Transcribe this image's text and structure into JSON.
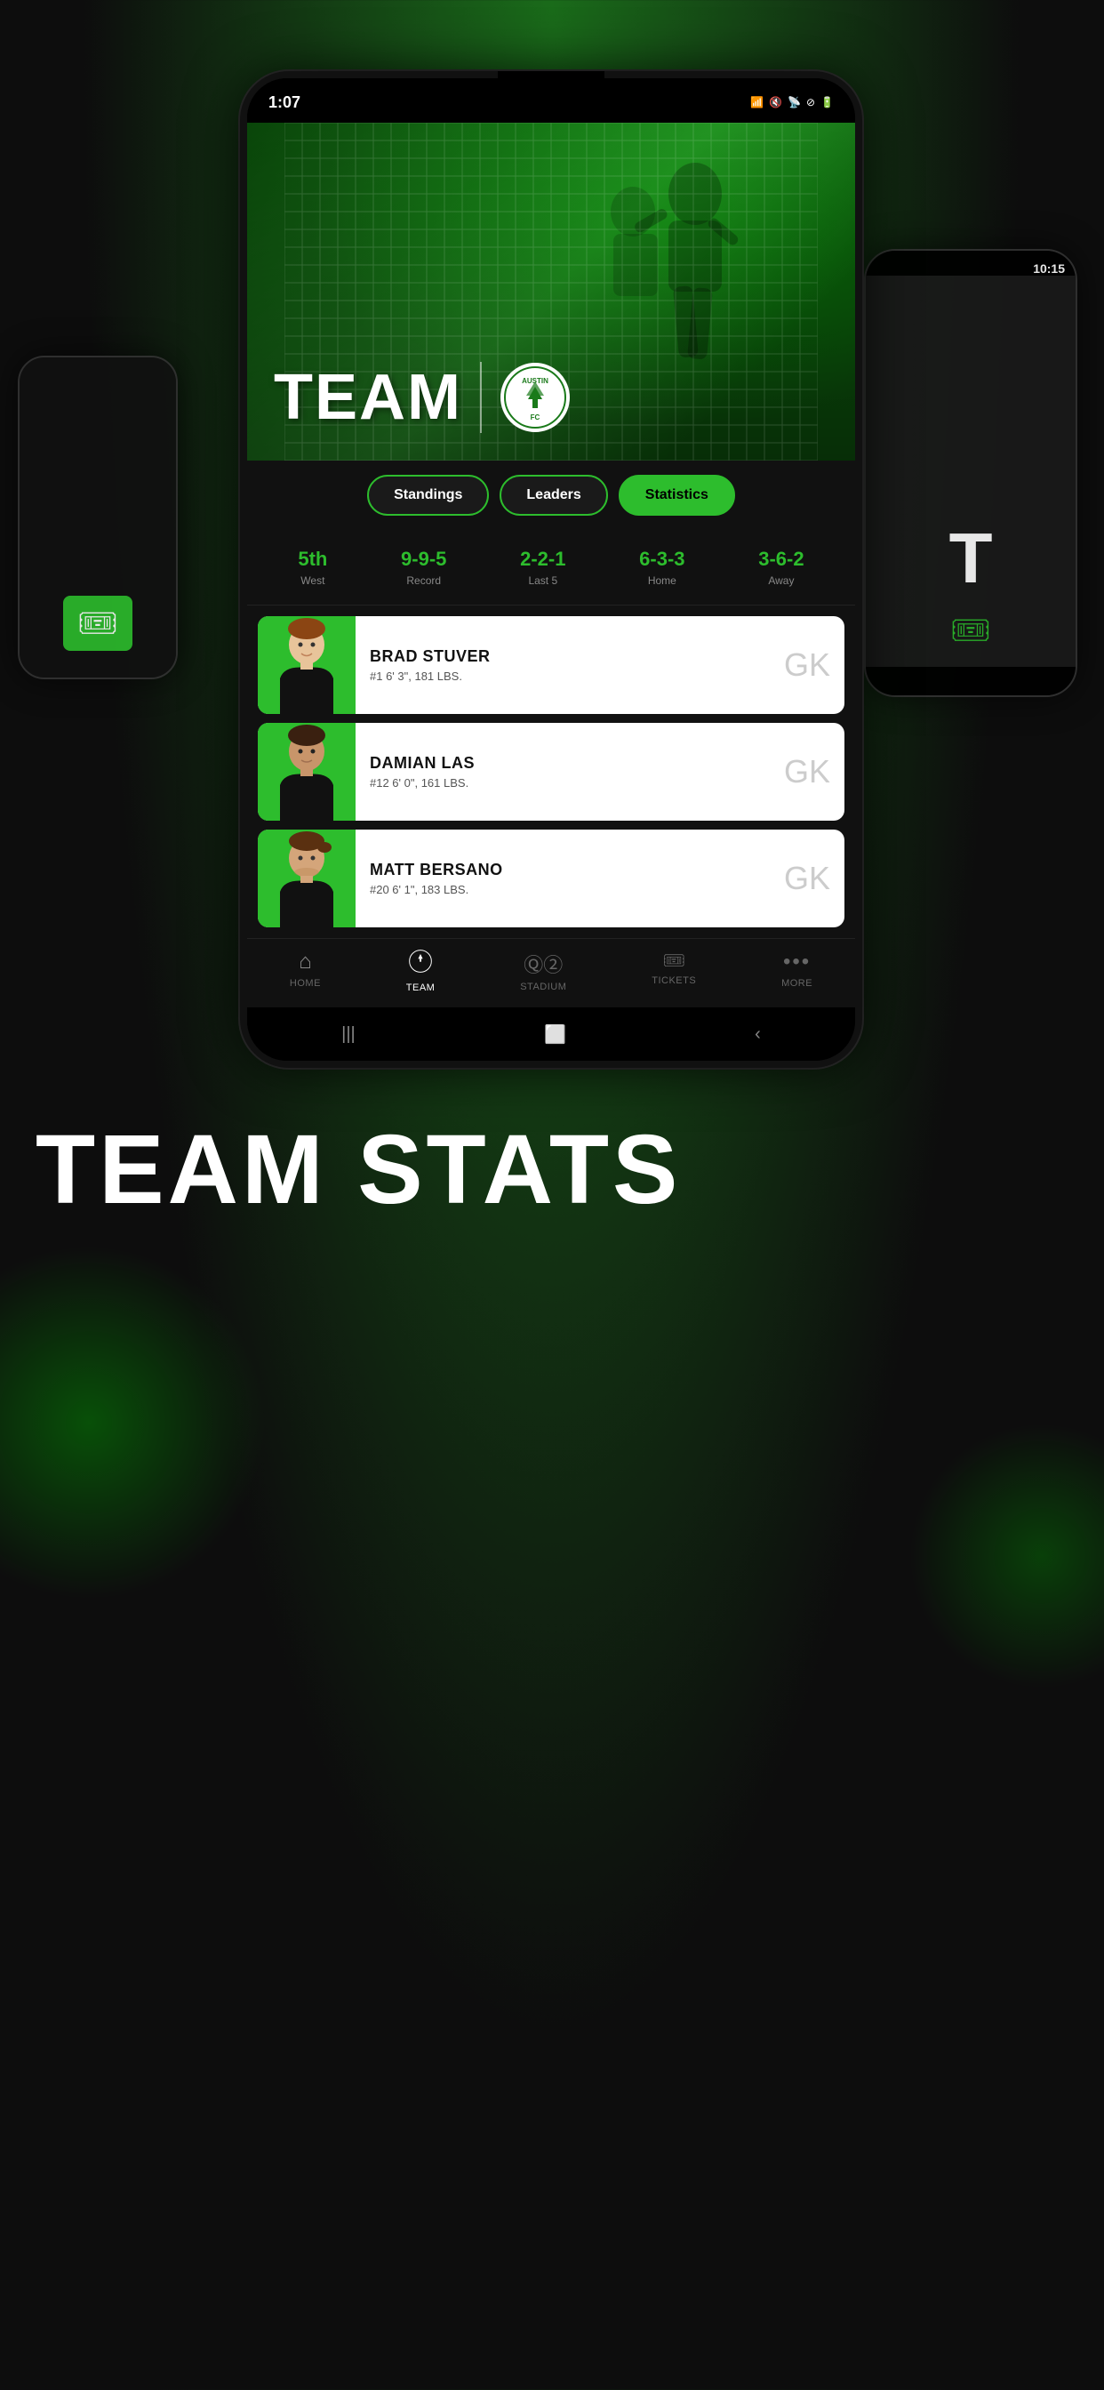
{
  "app": {
    "title": "Austin FC Team",
    "background_color": "#0d1a0d"
  },
  "status_bar": {
    "time": "1:07",
    "icons": [
      "sim",
      "mute",
      "wifi",
      "no-sim",
      "battery"
    ]
  },
  "hero": {
    "team_label": "TEAM",
    "team_name": "Austin FC"
  },
  "tabs": [
    {
      "id": "standings",
      "label": "Standings",
      "active": false
    },
    {
      "id": "leaders",
      "label": "Leaders",
      "active": false
    },
    {
      "id": "statistics",
      "label": "Statistics",
      "active": true
    }
  ],
  "team_stats": [
    {
      "value": "5th",
      "label": "West"
    },
    {
      "value": "9-9-5",
      "label": "Record"
    },
    {
      "value": "2-2-1",
      "label": "Last 5"
    },
    {
      "value": "6-3-3",
      "label": "Home"
    },
    {
      "value": "3-6-2",
      "label": "Away"
    }
  ],
  "players": [
    {
      "name": "BRAD STUVER",
      "details": "#1 6' 3\", 181 LBS.",
      "position": "GK"
    },
    {
      "name": "DAMIAN LAS",
      "details": "#12 6' 0\", 161 LBS.",
      "position": "GK"
    },
    {
      "name": "MATT BERSANO",
      "details": "#20 6' 1\", 183 LBS.",
      "position": "GK"
    }
  ],
  "bottom_nav": [
    {
      "id": "home",
      "label": "HOME",
      "icon": "🏠",
      "active": false
    },
    {
      "id": "team",
      "label": "TEAM",
      "icon": "⚽",
      "active": true
    },
    {
      "id": "stadium",
      "label": "STADIUM",
      "icon": "🅾",
      "active": false
    },
    {
      "id": "tickets",
      "label": "TICKETS",
      "icon": "🎫",
      "active": false
    },
    {
      "id": "more",
      "label": "MORE",
      "icon": "···",
      "active": false
    }
  ],
  "page_title": {
    "big_text": "TEAM STATS"
  },
  "bg_phone_right": {
    "time": "10:15"
  }
}
